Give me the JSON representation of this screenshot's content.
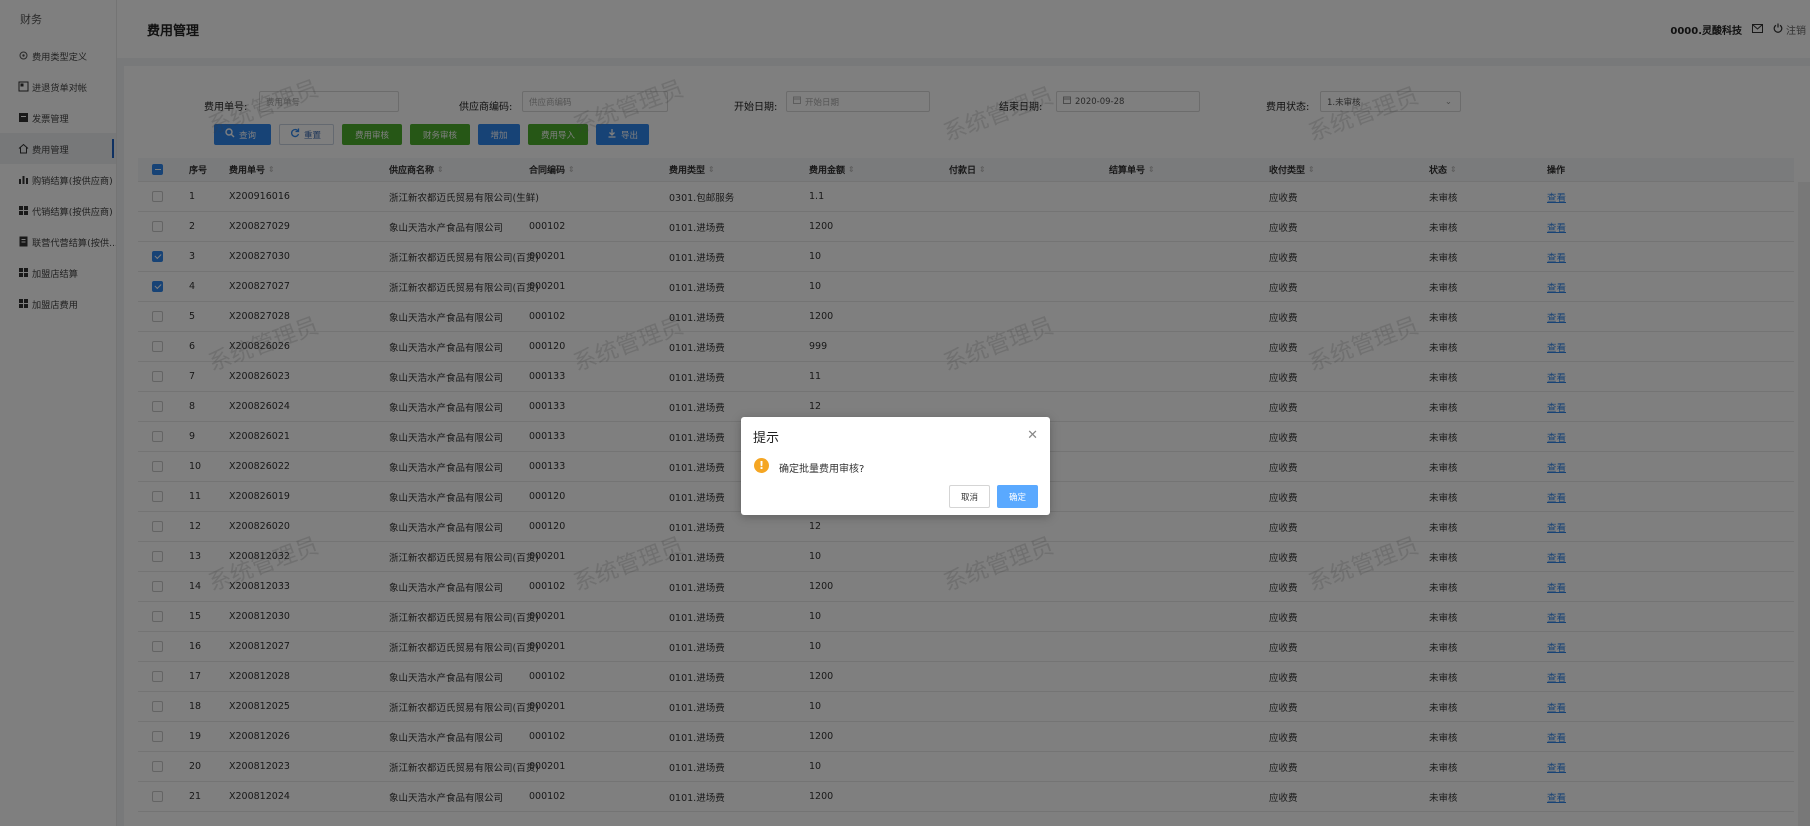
{
  "sidebar": {
    "title": "财务",
    "items": [
      {
        "label": "费用类型定义",
        "icon": "circle-dot-icon"
      },
      {
        "label": "进退货单对帐",
        "icon": "reconcile-icon"
      },
      {
        "label": "发票管理",
        "icon": "invoice-icon"
      },
      {
        "label": "费用管理",
        "icon": "home-icon",
        "active": true
      },
      {
        "label": "购销结算(按供应商)",
        "icon": "bar-chart-icon"
      },
      {
        "label": "代销结算(按供应商)",
        "icon": "grid-icon"
      },
      {
        "label": "联营代营结算(按供...",
        "icon": "ledger-icon"
      },
      {
        "label": "加盟店结算",
        "icon": "grid-icon"
      },
      {
        "label": "加盟店费用",
        "icon": "grid-icon"
      }
    ]
  },
  "header": {
    "title": "费用管理",
    "company": "0000.灵酸科技",
    "logout": "注销"
  },
  "filters": {
    "fee_no_label": "费用单号:",
    "fee_no_placeholder": "费用单号",
    "supplier_code_label": "供应商编码:",
    "supplier_code_placeholder": "供应商编码",
    "start_date_label": "开始日期:",
    "start_date_placeholder": "开始日期",
    "end_date_label": "结束日期:",
    "end_date_value": "2020-09-28",
    "status_label": "费用状态:",
    "status_value": "1.未审核"
  },
  "toolbar": {
    "query": "查询",
    "reset": "重置",
    "fee_audit": "费用审核",
    "finance_audit": "财务审核",
    "add": "增加",
    "fee_import": "费用导入",
    "export": "导出"
  },
  "table": {
    "columns": [
      "序号",
      "费用单号",
      "供应商名称",
      "合同编码",
      "费用类型",
      "费用金额",
      "付款日",
      "结算单号",
      "收付类型",
      "状态",
      "操作"
    ],
    "rows": [
      {
        "checked": false,
        "no": "1",
        "fee_no": "X200916016",
        "supplier": "浙江新农都迈氏贸易有限公司(生鲜)",
        "contract": "",
        "type": "0301.包邮服务",
        "amount": "1.1",
        "pay_day": "",
        "settle_no": "",
        "pay_type": "应收费",
        "status": "未审核",
        "action": "查看"
      },
      {
        "checked": false,
        "no": "2",
        "fee_no": "X200827029",
        "supplier": "象山天浩水产食品有限公司",
        "contract": "000102",
        "type": "0101.进场费",
        "amount": "1200",
        "pay_day": "",
        "settle_no": "",
        "pay_type": "应收费",
        "status": "未审核",
        "action": "查看"
      },
      {
        "checked": true,
        "no": "3",
        "fee_no": "X200827030",
        "supplier": "浙江新农都迈氏贸易有限公司(百货)",
        "contract": "000201",
        "type": "0101.进场费",
        "amount": "10",
        "pay_day": "",
        "settle_no": "",
        "pay_type": "应收费",
        "status": "未审核",
        "action": "查看"
      },
      {
        "checked": true,
        "no": "4",
        "fee_no": "X200827027",
        "supplier": "浙江新农都迈氏贸易有限公司(百货)",
        "contract": "000201",
        "type": "0101.进场费",
        "amount": "10",
        "pay_day": "",
        "settle_no": "",
        "pay_type": "应收费",
        "status": "未审核",
        "action": "查看"
      },
      {
        "checked": false,
        "no": "5",
        "fee_no": "X200827028",
        "supplier": "象山天浩水产食品有限公司",
        "contract": "000102",
        "type": "0101.进场费",
        "amount": "1200",
        "pay_day": "",
        "settle_no": "",
        "pay_type": "应收费",
        "status": "未审核",
        "action": "查看"
      },
      {
        "checked": false,
        "no": "6",
        "fee_no": "X200826026",
        "supplier": "象山天浩水产食品有限公司",
        "contract": "000120",
        "type": "0101.进场费",
        "amount": "999",
        "pay_day": "",
        "settle_no": "",
        "pay_type": "应收费",
        "status": "未审核",
        "action": "查看"
      },
      {
        "checked": false,
        "no": "7",
        "fee_no": "X200826023",
        "supplier": "象山天浩水产食品有限公司",
        "contract": "000133",
        "type": "0101.进场费",
        "amount": "11",
        "pay_day": "",
        "settle_no": "",
        "pay_type": "应收费",
        "status": "未审核",
        "action": "查看"
      },
      {
        "checked": false,
        "no": "8",
        "fee_no": "X200826024",
        "supplier": "象山天浩水产食品有限公司",
        "contract": "000133",
        "type": "0101.进场费",
        "amount": "12",
        "pay_day": "",
        "settle_no": "",
        "pay_type": "应收费",
        "status": "未审核",
        "action": "查看"
      },
      {
        "checked": false,
        "no": "9",
        "fee_no": "X200826021",
        "supplier": "象山天浩水产食品有限公司",
        "contract": "000133",
        "type": "0101.进场费",
        "amount": "",
        "pay_day": "",
        "settle_no": "",
        "pay_type": "应收费",
        "status": "未审核",
        "action": "查看"
      },
      {
        "checked": false,
        "no": "10",
        "fee_no": "X200826022",
        "supplier": "象山天浩水产食品有限公司",
        "contract": "000133",
        "type": "0101.进场费",
        "amount": "",
        "pay_day": "",
        "settle_no": "",
        "pay_type": "应收费",
        "status": "未审核",
        "action": "查看"
      },
      {
        "checked": false,
        "no": "11",
        "fee_no": "X200826019",
        "supplier": "象山天浩水产食品有限公司",
        "contract": "000120",
        "type": "0101.进场费",
        "amount": "",
        "pay_day": "",
        "settle_no": "",
        "pay_type": "应收费",
        "status": "未审核",
        "action": "查看"
      },
      {
        "checked": false,
        "no": "12",
        "fee_no": "X200826020",
        "supplier": "象山天浩水产食品有限公司",
        "contract": "000120",
        "type": "0101.进场费",
        "amount": "12",
        "pay_day": "",
        "settle_no": "",
        "pay_type": "应收费",
        "status": "未审核",
        "action": "查看"
      },
      {
        "checked": false,
        "no": "13",
        "fee_no": "X200812032",
        "supplier": "浙江新农都迈氏贸易有限公司(百货)",
        "contract": "000201",
        "type": "0101.进场费",
        "amount": "10",
        "pay_day": "",
        "settle_no": "",
        "pay_type": "应收费",
        "status": "未审核",
        "action": "查看"
      },
      {
        "checked": false,
        "no": "14",
        "fee_no": "X200812033",
        "supplier": "象山天浩水产食品有限公司",
        "contract": "000102",
        "type": "0101.进场费",
        "amount": "1200",
        "pay_day": "",
        "settle_no": "",
        "pay_type": "应收费",
        "status": "未审核",
        "action": "查看"
      },
      {
        "checked": false,
        "no": "15",
        "fee_no": "X200812030",
        "supplier": "浙江新农都迈氏贸易有限公司(百货)",
        "contract": "000201",
        "type": "0101.进场费",
        "amount": "10",
        "pay_day": "",
        "settle_no": "",
        "pay_type": "应收费",
        "status": "未审核",
        "action": "查看"
      },
      {
        "checked": false,
        "no": "16",
        "fee_no": "X200812027",
        "supplier": "浙江新农都迈氏贸易有限公司(百货)",
        "contract": "000201",
        "type": "0101.进场费",
        "amount": "10",
        "pay_day": "",
        "settle_no": "",
        "pay_type": "应收费",
        "status": "未审核",
        "action": "查看"
      },
      {
        "checked": false,
        "no": "17",
        "fee_no": "X200812028",
        "supplier": "象山天浩水产食品有限公司",
        "contract": "000102",
        "type": "0101.进场费",
        "amount": "1200",
        "pay_day": "",
        "settle_no": "",
        "pay_type": "应收费",
        "status": "未审核",
        "action": "查看"
      },
      {
        "checked": false,
        "no": "18",
        "fee_no": "X200812025",
        "supplier": "浙江新农都迈氏贸易有限公司(百货)",
        "contract": "000201",
        "type": "0101.进场费",
        "amount": "10",
        "pay_day": "",
        "settle_no": "",
        "pay_type": "应收费",
        "status": "未审核",
        "action": "查看"
      },
      {
        "checked": false,
        "no": "19",
        "fee_no": "X200812026",
        "supplier": "象山天浩水产食品有限公司",
        "contract": "000102",
        "type": "0101.进场费",
        "amount": "1200",
        "pay_day": "",
        "settle_no": "",
        "pay_type": "应收费",
        "status": "未审核",
        "action": "查看"
      },
      {
        "checked": false,
        "no": "20",
        "fee_no": "X200812023",
        "supplier": "浙江新农都迈氏贸易有限公司(百货)",
        "contract": "000201",
        "type": "0101.进场费",
        "amount": "10",
        "pay_day": "",
        "settle_no": "",
        "pay_type": "应收费",
        "status": "未审核",
        "action": "查看"
      },
      {
        "checked": false,
        "no": "21",
        "fee_no": "X200812024",
        "supplier": "象山天浩水产食品有限公司",
        "contract": "000102",
        "type": "0101.进场费",
        "amount": "1200",
        "pay_day": "",
        "settle_no": "",
        "pay_type": "应收费",
        "status": "未审核",
        "action": "查看"
      }
    ]
  },
  "watermark": "系统管理员",
  "dialog": {
    "title": "提示",
    "message": "确定批量费用审核?",
    "cancel": "取消",
    "ok": "确定"
  },
  "colors": {
    "primary": "#2f86ec",
    "success": "#4caf2d",
    "warning": "#f5a623",
    "mask": "rgba(0,0,0,0.5)"
  }
}
